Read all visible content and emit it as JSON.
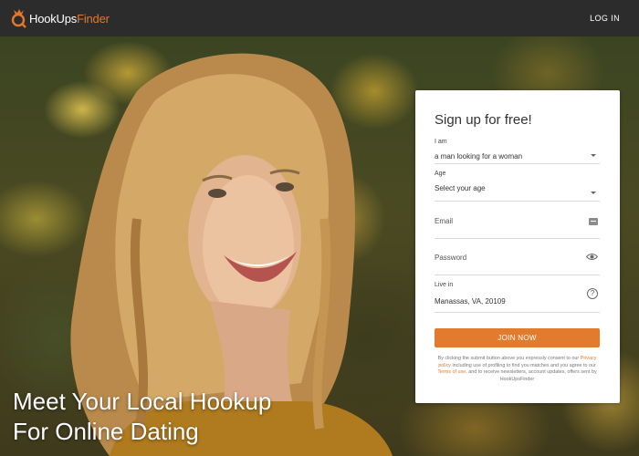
{
  "header": {
    "logo_text_a": "HookUps",
    "logo_text_b": "Finder",
    "login_label": "LOG IN"
  },
  "hero": {
    "headline_line1": "Meet Your Local Hookup",
    "headline_line2": "For Online Dating"
  },
  "signup": {
    "title": "Sign up for free!",
    "iam_label": "I am",
    "iam_value": "a man looking for a woman",
    "age_label": "Age",
    "age_value": "Select your age",
    "email_placeholder": "Email",
    "password_placeholder": "Password",
    "live_label": "Live in",
    "live_value": "Manassas, VA, 20109",
    "help_glyph": "?",
    "join_label": "JOIN NOW",
    "disclaimer_1": "By clicking the submit button above you expressly consent to our ",
    "privacy_link": "Privacy policy",
    "disclaimer_2": " including use of profiling to find you matches and you agree to our ",
    "terms_link": "Terms of use",
    "disclaimer_3": ", and to receive newsletters, account updates, offers sent by HookUpsFinder"
  },
  "colors": {
    "accent": "#e37b2f",
    "header_bg": "#2c2c2c",
    "card_bg": "#ffffff"
  },
  "icons": [
    "logo-icon",
    "chevron-down-icon",
    "email-icon",
    "eye-icon",
    "help-icon"
  ]
}
